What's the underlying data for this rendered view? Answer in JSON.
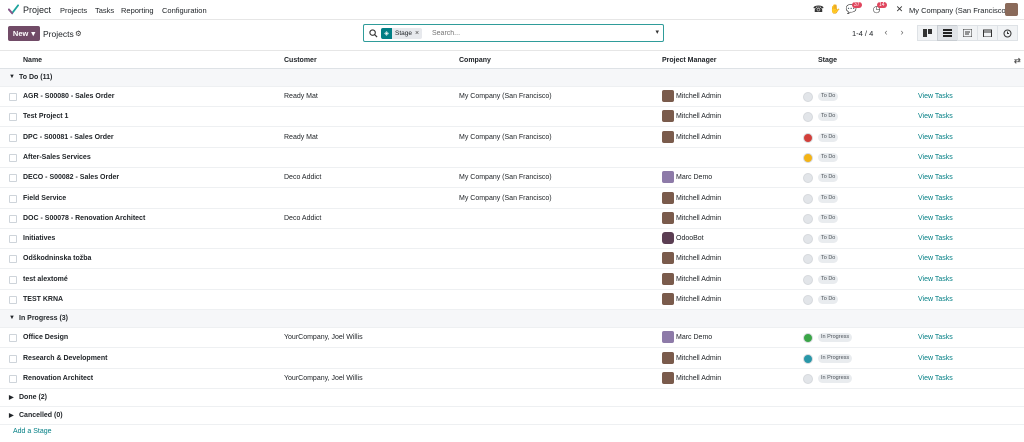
{
  "navbar": {
    "app_title": "Project",
    "menu": [
      "Projects",
      "Tasks",
      "Reporting",
      "Configuration"
    ],
    "badges": {
      "messages": "37",
      "activities": "14"
    },
    "company": "My Company (San Francisco)"
  },
  "control": {
    "new_label": "New",
    "breadcrumb": "Projects",
    "facet_label": "Stage",
    "search_placeholder": "Search...",
    "pager": "1-4 / 4"
  },
  "columns": {
    "name": "Name",
    "customer": "Customer",
    "company": "Company",
    "manager": "Project Manager",
    "stage": "Stage"
  },
  "groups": [
    {
      "label": "To Do (11)",
      "expanded": true,
      "rows": [
        {
          "name": "AGR - S00080 - Sales Order",
          "customer": "Ready Mat",
          "company": "My Company (San Francisco)",
          "manager": "Mitchell Admin",
          "status_color": "#e2e5e9",
          "stage": "To Do",
          "link": "View Tasks"
        },
        {
          "name": "Test Project 1",
          "customer": "",
          "company": "",
          "manager": "Mitchell Admin",
          "status_color": "#e2e5e9",
          "stage": "To Do",
          "link": "View Tasks"
        },
        {
          "name": "DPC - S00081 - Sales Order",
          "customer": "Ready Mat",
          "company": "My Company (San Francisco)",
          "manager": "Mitchell Admin",
          "status_color": "#d23f3a",
          "stage": "To Do",
          "link": "View Tasks"
        },
        {
          "name": "After-Sales Services",
          "customer": "",
          "company": "",
          "manager": "",
          "status_color": "#f3b316",
          "stage": "To Do",
          "link": "View Tasks"
        },
        {
          "name": "DECO - S00082 - Sales Order",
          "customer": "Deco Addict",
          "company": "My Company (San Francisco)",
          "manager": "Marc Demo",
          "status_color": "#e2e5e9",
          "stage": "To Do",
          "link": "View Tasks"
        },
        {
          "name": "Field Service",
          "customer": "",
          "company": "My Company (San Francisco)",
          "manager": "Mitchell Admin",
          "status_color": "#e2e5e9",
          "stage": "To Do",
          "link": "View Tasks"
        },
        {
          "name": "DOC - S00078 - Renovation Architect",
          "customer": "Deco Addict",
          "company": "",
          "manager": "Mitchell Admin",
          "status_color": "#e2e5e9",
          "stage": "To Do",
          "link": "View Tasks"
        },
        {
          "name": "Initiatives",
          "customer": "",
          "company": "",
          "manager": "OdooBot",
          "status_color": "#e2e5e9",
          "stage": "To Do",
          "link": "View Tasks"
        },
        {
          "name": "Odškodninska tožba",
          "customer": "",
          "company": "",
          "manager": "Mitchell Admin",
          "status_color": "#e2e5e9",
          "stage": "To Do",
          "link": "View Tasks"
        },
        {
          "name": "test alextomé",
          "customer": "",
          "company": "",
          "manager": "Mitchell Admin",
          "status_color": "#e2e5e9",
          "stage": "To Do",
          "link": "View Tasks"
        },
        {
          "name": "TEST KRNA",
          "customer": "",
          "company": "",
          "manager": "Mitchell Admin",
          "status_color": "#e2e5e9",
          "stage": "To Do",
          "link": "View Tasks"
        }
      ]
    },
    {
      "label": "In Progress (3)",
      "expanded": true,
      "rows": [
        {
          "name": "Office Design",
          "customer": "YourCompany, Joel Willis",
          "company": "",
          "manager": "Marc Demo",
          "status_color": "#3aa547",
          "stage": "In Progress",
          "link": "View Tasks"
        },
        {
          "name": "Research & Development",
          "customer": "",
          "company": "",
          "manager": "Mitchell Admin",
          "status_color": "#2897a8",
          "stage": "In Progress",
          "link": "View Tasks"
        },
        {
          "name": "Renovation Architect",
          "customer": "YourCompany, Joel Willis",
          "company": "",
          "manager": "Mitchell Admin",
          "status_color": "#e2e5e9",
          "stage": "In Progress",
          "link": "View Tasks"
        }
      ]
    },
    {
      "label": "Done (2)",
      "expanded": false,
      "rows": []
    },
    {
      "label": "Cancelled (0)",
      "expanded": false,
      "rows": []
    }
  ],
  "footer": {
    "add_stage": "Add a Stage"
  },
  "colors": {
    "brand": "#714b67",
    "accent": "#017e84"
  }
}
